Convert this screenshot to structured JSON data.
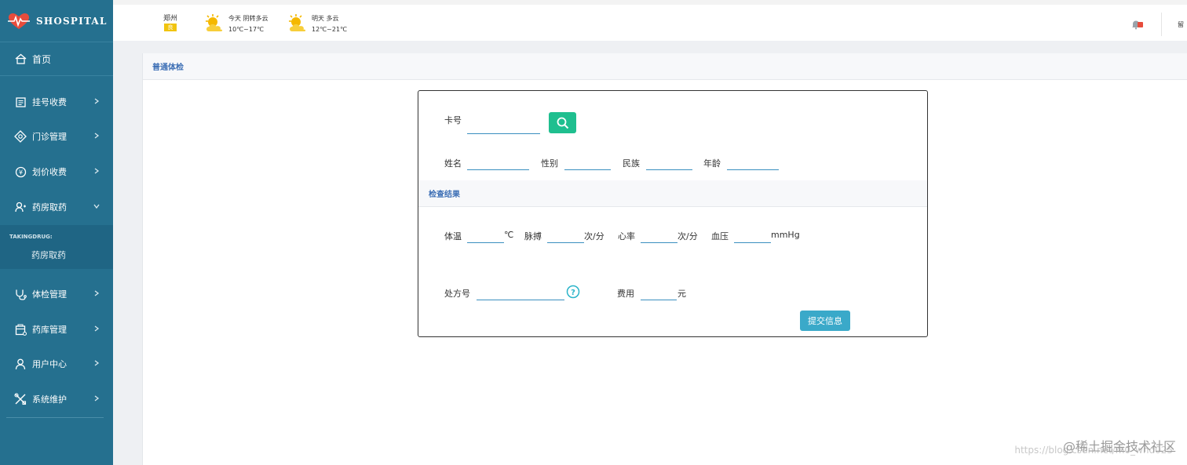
{
  "brand": {
    "name": "SHOSPITAL"
  },
  "sidebar": {
    "home": "首页",
    "items": [
      {
        "label": "挂号收费",
        "icon": "register-icon"
      },
      {
        "label": "门诊管理",
        "icon": "diamond-icon"
      },
      {
        "label": "划价收费",
        "icon": "pricing-icon"
      },
      {
        "label": "药房取药",
        "icon": "pharmacy-icon"
      },
      {
        "label": "体检管理",
        "icon": "stethoscope-icon"
      },
      {
        "label": "药库管理",
        "icon": "storage-icon"
      },
      {
        "label": "用户中心",
        "icon": "user-icon"
      },
      {
        "label": "系统维护",
        "icon": "tools-icon"
      }
    ],
    "submenu": {
      "title": "TAKINGDRUG:",
      "item": "药房取药"
    }
  },
  "topbar": {
    "city": "郑州",
    "aqi": "良",
    "today": {
      "line1": "今天  阴转多云",
      "line2": "10℃~17℃"
    },
    "tomorrow": {
      "line1": "明天  多云",
      "line2": "12℃~21℃"
    },
    "right_text": "留"
  },
  "page": {
    "title": "普通体检"
  },
  "form": {
    "card_label": "卡号",
    "name_label": "姓名",
    "gender_label": "性别",
    "ethnicity_label": "民族",
    "age_label": "年龄",
    "result_title": "检查结果",
    "temp_label": "体温",
    "temp_unit": "℃",
    "pulse_label": "脉搏",
    "pulse_unit": "次/分",
    "heart_label": "心率",
    "heart_unit": "次/分",
    "bp_label": "血压",
    "bp_unit": "mmHg",
    "rx_label": "处方号",
    "fee_label": "费用",
    "fee_unit": "元",
    "submit_label": "提交信息"
  },
  "watermark": {
    "text": "@稀土掘金技术社区",
    "url": "https://blog.csdn.net/m0_wnd025"
  },
  "colors": {
    "sidebar": "#25708f",
    "accent": "#3d6fb5",
    "search": "#1fbf8f",
    "submit": "#3aa9c9"
  }
}
